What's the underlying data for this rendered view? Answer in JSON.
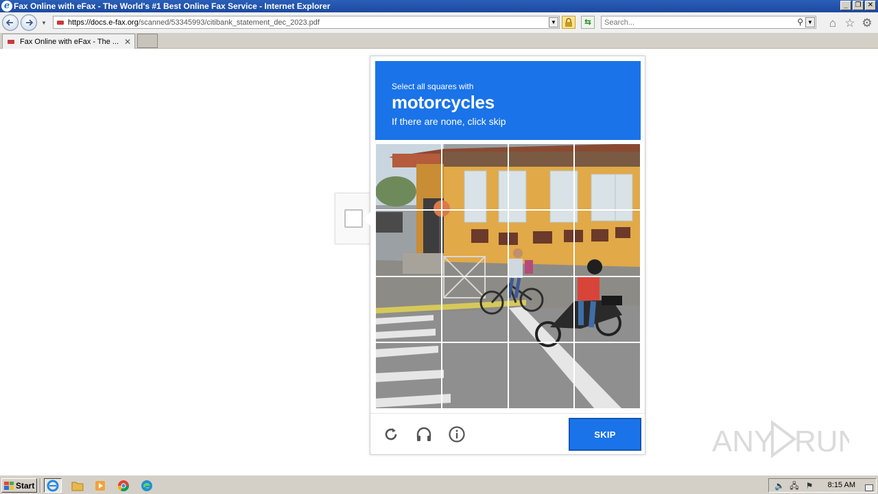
{
  "window": {
    "title": "Fax Online with eFax - The World's #1 Best Online Fax Service - Internet Explorer",
    "app_icon": "ie-logo-icon",
    "controls": [
      "minimize",
      "restore",
      "close"
    ]
  },
  "navbar": {
    "url_host": "https://docs.e-fax.org",
    "url_path": "/scanned/53345993/citibank_statement_dec_2023.pdf",
    "search_placeholder": "Search..."
  },
  "tabs": [
    {
      "label": "Fax Online with eFax - The ...",
      "active": true
    }
  ],
  "captcha": {
    "intro": "Select all squares with",
    "keyword": "motorcycles",
    "hint": "If there are none, click skip",
    "grid_rows": 4,
    "grid_cols": 4,
    "skip_label": "SKIP",
    "footer_icons": [
      "reload-icon",
      "audio-headphones-icon",
      "info-icon"
    ],
    "header_color": "#1a73e8"
  },
  "watermark": {
    "text": "ANY RUN"
  },
  "taskbar": {
    "start_label": "Start",
    "apps": [
      "internet-explorer",
      "file-explorer",
      "media-player",
      "chrome",
      "edge"
    ],
    "clock": "8:15 AM"
  }
}
